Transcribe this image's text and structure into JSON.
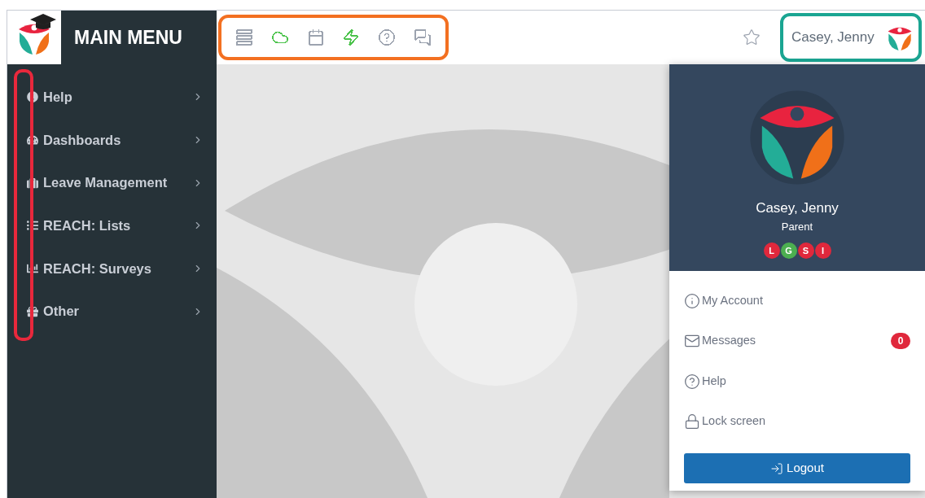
{
  "sidebar": {
    "title": "MAIN MENU",
    "items": [
      {
        "kind": "info",
        "label": "Help"
      },
      {
        "kind": "dashboard",
        "label": "Dashboards"
      },
      {
        "kind": "suitcase",
        "label": "Leave Management"
      },
      {
        "kind": "list",
        "label": "REACH: Lists"
      },
      {
        "kind": "chart",
        "label": "REACH: Surveys"
      },
      {
        "kind": "gift",
        "label": "Other"
      }
    ]
  },
  "toolbar_icons": [
    {
      "kind": "stack",
      "color": "#9ca3af"
    },
    {
      "kind": "cloud",
      "color": "#4cc34c"
    },
    {
      "kind": "calendar",
      "color": "#9ca3af"
    },
    {
      "kind": "bolt",
      "color": "#4cc34c"
    },
    {
      "kind": "help",
      "color": "#9ca3af"
    },
    {
      "kind": "chat",
      "color": "#9ca3af"
    }
  ],
  "user": {
    "name": "Casey, Jenny"
  },
  "profile_menu": {
    "name": "Casey, Jenny",
    "role": "Parent",
    "badges": [
      {
        "label": "L",
        "color": "#e0283c"
      },
      {
        "label": "G",
        "color": "#4caf50"
      },
      {
        "label": "S",
        "color": "#e0283c"
      },
      {
        "label": "I",
        "color": "#e0283c"
      }
    ],
    "items": [
      {
        "kind": "account",
        "label": "My Account"
      },
      {
        "kind": "messages",
        "label": "Messages",
        "count": "0"
      },
      {
        "kind": "help",
        "label": "Help"
      },
      {
        "kind": "lock",
        "label": "Lock screen"
      }
    ],
    "logout": "Logout"
  }
}
